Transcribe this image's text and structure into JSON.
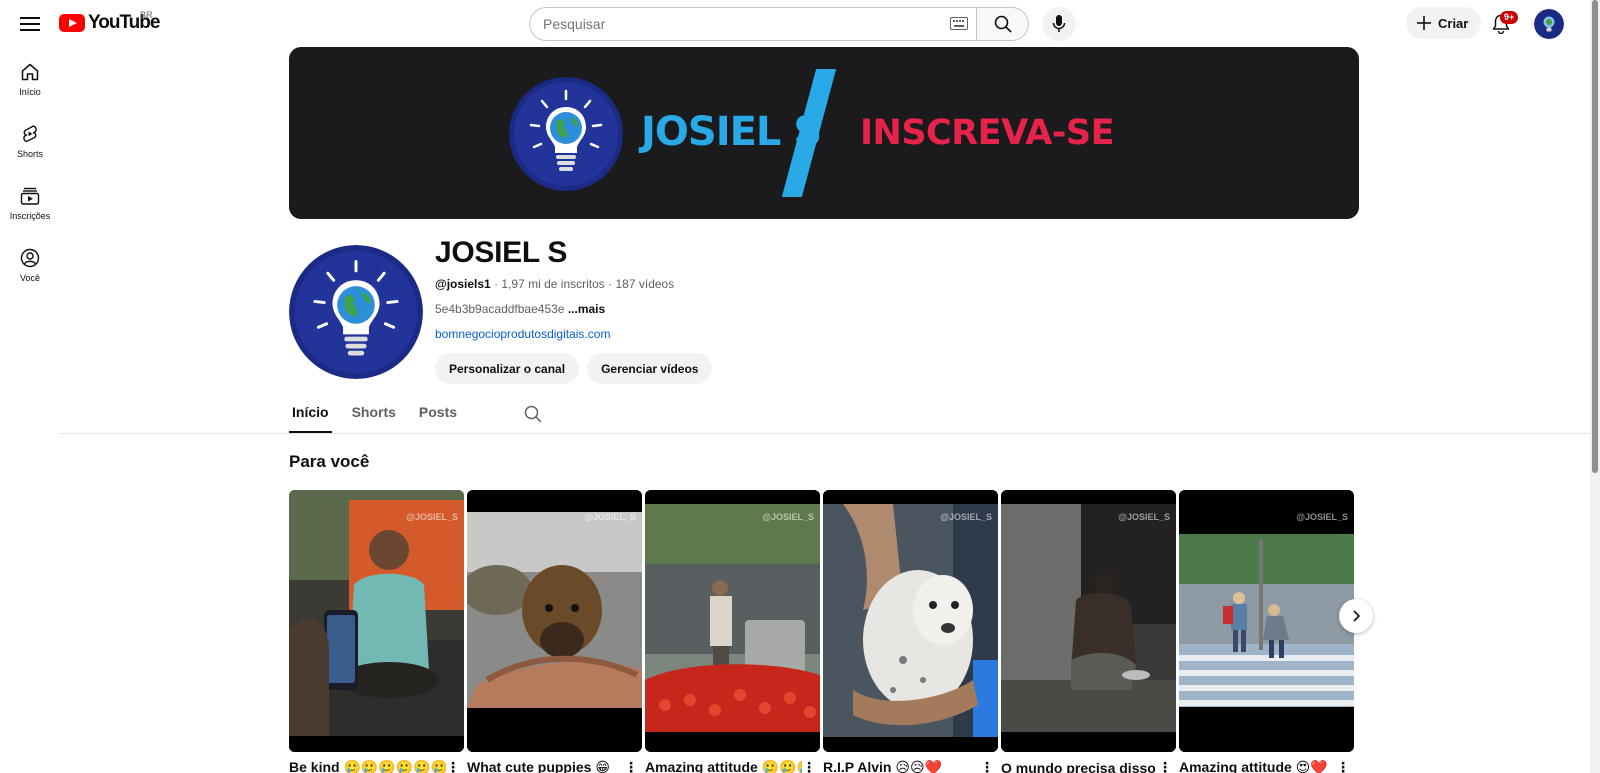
{
  "header": {
    "logo_text": "YouTube",
    "country_code": "BR",
    "search_placeholder": "Pesquisar",
    "create_label": "Criar",
    "notifications_badge": "9+"
  },
  "sidebar": {
    "items": [
      {
        "label": "Início",
        "icon": "home-icon"
      },
      {
        "label": "Shorts",
        "icon": "shorts-icon"
      },
      {
        "label": "Inscrições",
        "icon": "subscriptions-icon"
      },
      {
        "label": "Você",
        "icon": "you-icon"
      }
    ]
  },
  "banner": {
    "name": "JOSIEL S",
    "cta": "INSCREVA-SE"
  },
  "channel": {
    "title": "JOSIEL S",
    "handle": "@josiels1",
    "subscribers": "1,97 mi de inscritos",
    "videos": "187 vídeos",
    "description": "5e4b3b9acaddfbae453e",
    "more_label": "...mais",
    "link": "bomnegocioprodutosdigitais.com",
    "customize_button": "Personalizar o canal",
    "manage_button": "Gerenciar vídeos"
  },
  "tabs": [
    {
      "label": "Início",
      "active": true
    },
    {
      "label": "Shorts",
      "active": false
    },
    {
      "label": "Posts",
      "active": false
    }
  ],
  "shelf": {
    "title": "Para você",
    "shorts": [
      {
        "title": "Be kind 🥲🥲🥲🥲🥲🥲🥲",
        "watermark": "@JOSIEL_S"
      },
      {
        "title": "What cute puppies 😁",
        "watermark": "@JOSIEL_S"
      },
      {
        "title": "Amazing attitude 🥲🥲🥲🥲🥲",
        "watermark": "@JOSIEL_S"
      },
      {
        "title": "R.I.P Alvin 😥😥❤️",
        "watermark": "@JOSIEL_S"
      },
      {
        "title": "O mundo precisa disso",
        "watermark": "@JOSIEL_S"
      },
      {
        "title": "Amazing attitude 😍❤️",
        "watermark": "@JOSIEL_S"
      }
    ]
  },
  "colors": {
    "brand_red": "#ff0000",
    "link_blue": "#065fd4",
    "banner_blue": "#29a9e6",
    "banner_red": "#e8234b"
  }
}
